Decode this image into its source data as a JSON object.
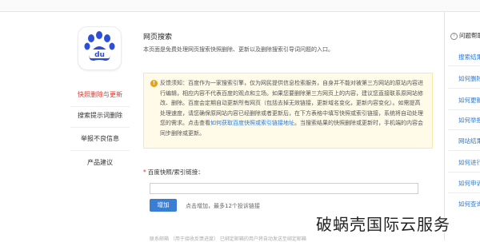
{
  "sidebar": {
    "items": [
      {
        "label": "快照删除与更新",
        "active": true
      },
      {
        "label": "搜索提示词删除",
        "active": false
      },
      {
        "label": "举报不良信息",
        "active": false
      },
      {
        "label": "产品建议",
        "active": false
      }
    ]
  },
  "main": {
    "title": "网页搜索",
    "description": "本页面是免费处理网页搜索快照删除、更新以及删除搜索引导词问题的入口。",
    "notice": {
      "icon": "!",
      "text_1": "反馈须知：百度作为一家搜索引擎，仅为网民提供信息检索服务，自身并不能对被第三方网站的原站内容进行编辑，相应内容不代表百度的观点和立场。如果您要删除第三方网页上的内容，建议您直接联系原网站修改、删除。百度会定期自动更新所有网页（包括去掉无效链接，更新域名变化，更新内容变化）。如需提高处理速度，请您确保原网站内容已经删除或者更新后，在下方表格中填写快照或索引链接，系统将自动处理您的需求。点击查看",
      "link": "如何获取百度快照或索引链接地址",
      "text_2": "。当搜索结果的快照删除或更新时，手机端的内容会同步删除或更新。"
    },
    "field_label": "百度快照/索引链接：",
    "field_required": "*",
    "input_value": "",
    "add_button": "增加",
    "add_hint": "点击增加，最多12个投诉链接",
    "bottom_text": "联系邮箱  （用于接收反馈进度）  已绑定邮箱的用户将自动发送至绑定邮箱"
  },
  "help": {
    "title": "问题帮助",
    "title_icon": "?",
    "links": [
      "搜索结果",
      "如何删除",
      "如何更新",
      "如何举报",
      "网站结果",
      "如何进行",
      "如何申诉",
      "如何查询"
    ]
  },
  "watermark": "破蜗壳国际云服务",
  "colors": {
    "accent": "#d9352c",
    "link": "#2d78d3",
    "button": "#3a7ed4",
    "notice_bg": "#fffbe8"
  },
  "icons": {
    "logo": "baidu-paw-logo",
    "notice": "exclamation-circle-icon",
    "help": "question-circle-icon"
  }
}
